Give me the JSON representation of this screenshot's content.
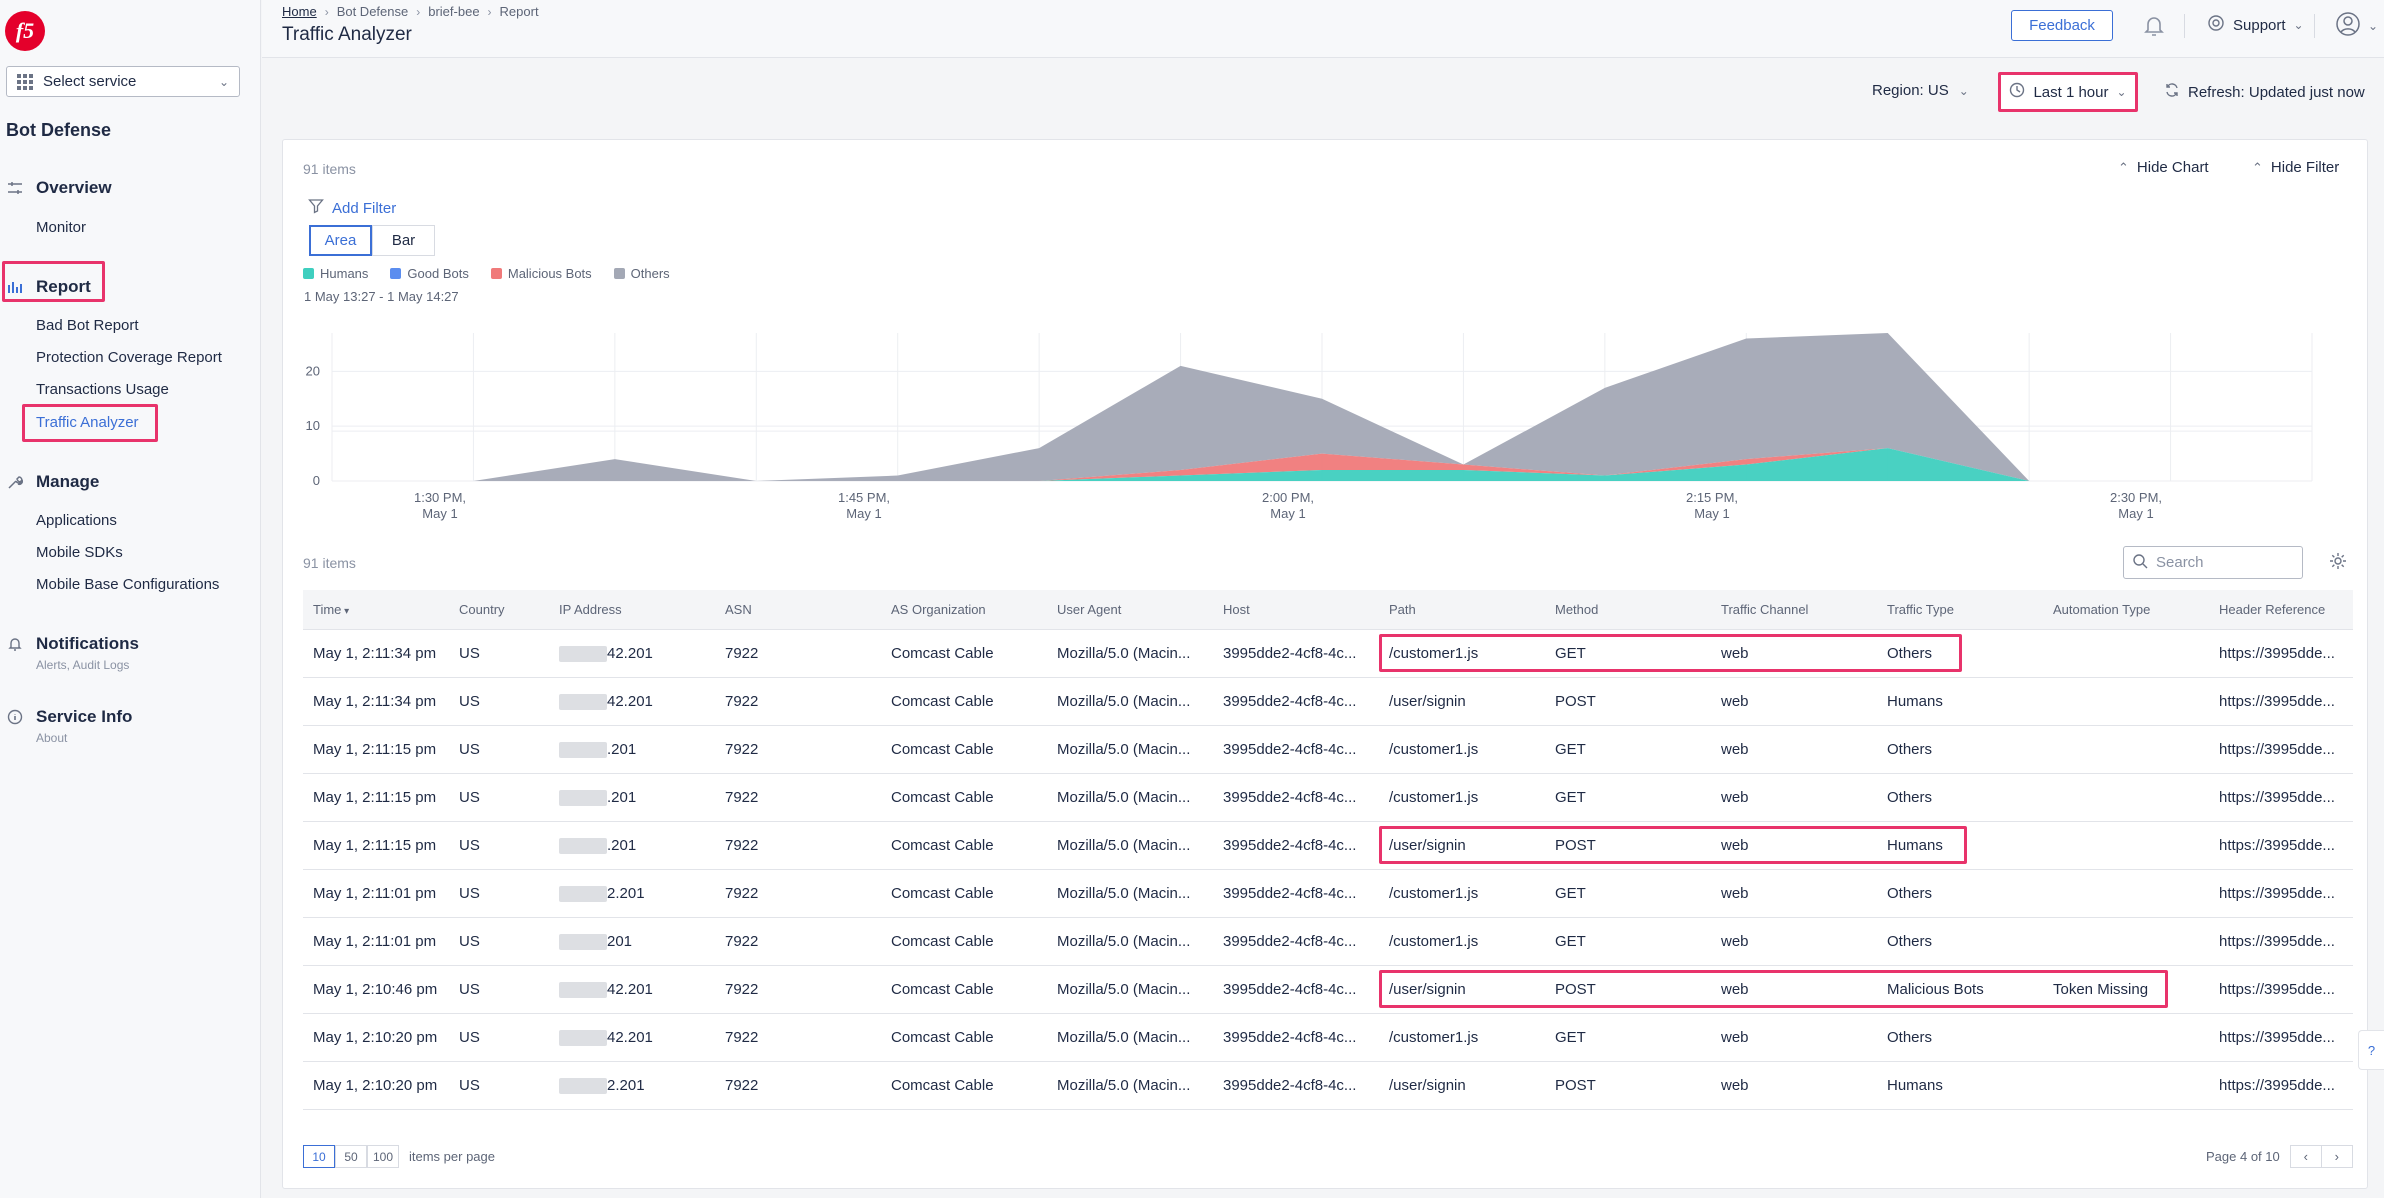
{
  "sidebar": {
    "logo_text": "f5",
    "select_service": "Select service",
    "product_title": "Bot Defense",
    "sections": {
      "overview": {
        "label": "Overview",
        "items": [
          "Monitor"
        ]
      },
      "report": {
        "label": "Report",
        "items": [
          "Bad Bot Report",
          "Protection Coverage Report",
          "Transactions Usage",
          "Traffic Analyzer"
        ]
      },
      "manage": {
        "label": "Manage",
        "items": [
          "Applications",
          "Mobile SDKs",
          "Mobile Base Configurations"
        ]
      },
      "notifications": {
        "label": "Notifications",
        "sub": "Alerts, Audit Logs"
      },
      "service_info": {
        "label": "Service Info",
        "sub": "About"
      }
    }
  },
  "header": {
    "breadcrumb": [
      "Home",
      "Bot Defense",
      "brief-bee",
      "Report"
    ],
    "title": "Traffic Analyzer",
    "feedback": "Feedback",
    "support": "Support"
  },
  "toolbar": {
    "region": "Region: US",
    "time_range": "Last 1 hour",
    "refresh": "Refresh: Updated just now"
  },
  "chart_panel": {
    "items_count": "91 items",
    "hide_chart": "Hide Chart",
    "hide_filter": "Hide Filter",
    "add_filter": "Add Filter",
    "view_toggle": [
      "Area",
      "Bar"
    ],
    "active_view": "Area",
    "range_label": "1 May 13:27 - 1 May 14:27"
  },
  "chart_data": {
    "type": "area",
    "stacked": true,
    "series": [
      {
        "name": "Humans",
        "color": "#3fcfbf",
        "values": [
          0,
          0,
          0,
          0,
          0,
          1,
          2,
          2,
          1,
          3,
          6,
          0,
          0
        ]
      },
      {
        "name": "Good Bots",
        "color": "#5b8def",
        "values": [
          0,
          0,
          0,
          0,
          0,
          0,
          0,
          0,
          0,
          0,
          0,
          0,
          0
        ]
      },
      {
        "name": "Malicious Bots",
        "color": "#f07a7a",
        "values": [
          0,
          0,
          0,
          0,
          0,
          1,
          3,
          1,
          0,
          1,
          0,
          0,
          0
        ]
      },
      {
        "name": "Others",
        "color": "#a3a8b5",
        "values": [
          0,
          4,
          0,
          1,
          6,
          19,
          10,
          0,
          16,
          22,
          21,
          0,
          0
        ]
      }
    ],
    "x_ticks": [
      {
        "t1": "1:30 PM,",
        "t2": "May 1"
      },
      {
        "t1": "1:45 PM,",
        "t2": "May 1"
      },
      {
        "t1": "2:00 PM,",
        "t2": "May 1"
      },
      {
        "t1": "2:15 PM,",
        "t2": "May 1"
      },
      {
        "t1": "2:30 PM,",
        "t2": "May 1"
      }
    ],
    "y_ticks": [
      0,
      10,
      20
    ],
    "ylim": [
      0,
      27
    ],
    "grid": true,
    "legend_position": "top-left"
  },
  "table_panel": {
    "items_count": "91 items",
    "search_placeholder": "Search",
    "columns": [
      "Time",
      "Country",
      "IP Address",
      "ASN",
      "AS Organization",
      "User Agent",
      "Host",
      "Path",
      "Method",
      "Traffic Channel",
      "Traffic Type",
      "Automation Type",
      "Header Reference"
    ],
    "rows": [
      [
        "May 1, 2:11:34 pm",
        "US",
        "42.201",
        "7922",
        "Comcast Cable",
        "Mozilla/5.0 (Macin...",
        "3995dde2-4cf8-4c...",
        "/customer1.js",
        "GET",
        "web",
        "Others",
        "",
        "https://3995dde..."
      ],
      [
        "May 1, 2:11:34 pm",
        "US",
        "42.201",
        "7922",
        "Comcast Cable",
        "Mozilla/5.0 (Macin...",
        "3995dde2-4cf8-4c...",
        "/user/signin",
        "POST",
        "web",
        "Humans",
        "",
        "https://3995dde..."
      ],
      [
        "May 1, 2:11:15 pm",
        "US",
        ".201",
        "7922",
        "Comcast Cable",
        "Mozilla/5.0 (Macin...",
        "3995dde2-4cf8-4c...",
        "/customer1.js",
        "GET",
        "web",
        "Others",
        "",
        "https://3995dde..."
      ],
      [
        "May 1, 2:11:15 pm",
        "US",
        ".201",
        "7922",
        "Comcast Cable",
        "Mozilla/5.0 (Macin...",
        "3995dde2-4cf8-4c...",
        "/customer1.js",
        "GET",
        "web",
        "Others",
        "",
        "https://3995dde..."
      ],
      [
        "May 1, 2:11:15 pm",
        "US",
        ".201",
        "7922",
        "Comcast Cable",
        "Mozilla/5.0 (Macin...",
        "3995dde2-4cf8-4c...",
        "/user/signin",
        "POST",
        "web",
        "Humans",
        "",
        "https://3995dde..."
      ],
      [
        "May 1, 2:11:01 pm",
        "US",
        "2.201",
        "7922",
        "Comcast Cable",
        "Mozilla/5.0 (Macin...",
        "3995dde2-4cf8-4c...",
        "/customer1.js",
        "GET",
        "web",
        "Others",
        "",
        "https://3995dde..."
      ],
      [
        "May 1, 2:11:01 pm",
        "US",
        "201",
        "7922",
        "Comcast Cable",
        "Mozilla/5.0 (Macin...",
        "3995dde2-4cf8-4c...",
        "/customer1.js",
        "GET",
        "web",
        "Others",
        "",
        "https://3995dde..."
      ],
      [
        "May 1, 2:10:46 pm",
        "US",
        "42.201",
        "7922",
        "Comcast Cable",
        "Mozilla/5.0 (Macin...",
        "3995dde2-4cf8-4c...",
        "/user/signin",
        "POST",
        "web",
        "Malicious Bots",
        "Token Missing",
        "https://3995dde..."
      ],
      [
        "May 1, 2:10:20 pm",
        "US",
        "42.201",
        "7922",
        "Comcast Cable",
        "Mozilla/5.0 (Macin...",
        "3995dde2-4cf8-4c...",
        "/customer1.js",
        "GET",
        "web",
        "Others",
        "",
        "https://3995dde..."
      ],
      [
        "May 1, 2:10:20 pm",
        "US",
        "2.201",
        "7922",
        "Comcast Cable",
        "Mozilla/5.0 (Macin...",
        "3995dde2-4cf8-4c...",
        "/user/signin",
        "POST",
        "web",
        "Humans",
        "",
        "https://3995dde..."
      ]
    ],
    "page_sizes": [
      "10",
      "50",
      "100"
    ],
    "active_page_size": "10",
    "items_per_page": "items per page",
    "page_label": "Page 4 of 10"
  },
  "colors": {
    "accent": "#3b6fd6",
    "highlight": "#e8336b",
    "brand": "#e4002b"
  }
}
